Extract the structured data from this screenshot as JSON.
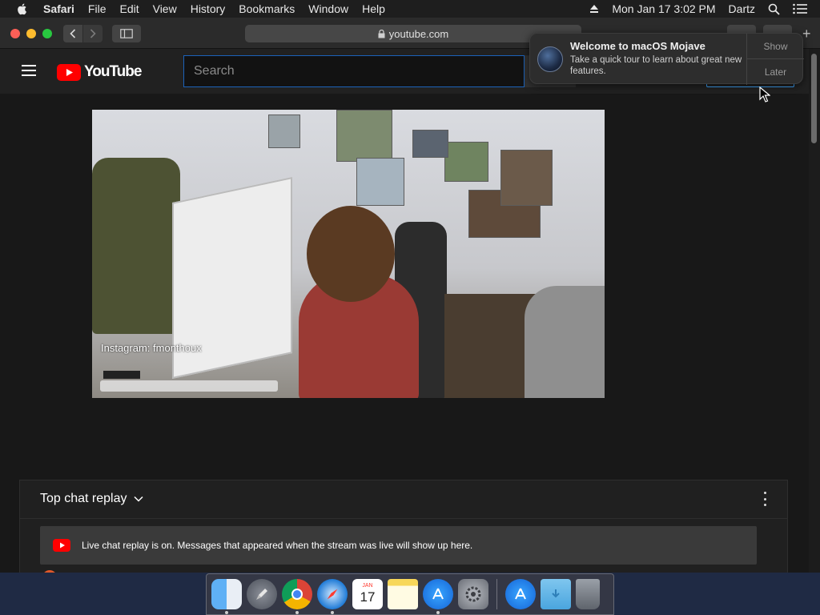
{
  "menubar": {
    "app_name": "Safari",
    "items": [
      "File",
      "Edit",
      "View",
      "History",
      "Bookmarks",
      "Window",
      "Help"
    ],
    "datetime": "Mon Jan 17  3:02 PM",
    "user": "Dartz"
  },
  "browser": {
    "url": "youtube.com"
  },
  "youtube": {
    "logo_text": "YouTube",
    "search_placeholder": "Search",
    "video_caption": "Instagram: fmonthoux",
    "chat": {
      "title": "Top chat replay",
      "banner_text": "Live chat replay is on. Messages that appeared when the stream was live will show up here."
    }
  },
  "notification": {
    "title": "Welcome to macOS Mojave",
    "body": "Take a quick tour to learn about great new features.",
    "show_label": "Show",
    "later_label": "Later"
  },
  "dock": {
    "calendar_month": "JAN",
    "calendar_day": "17",
    "apps": [
      "finder",
      "launchpad",
      "chrome",
      "safari",
      "calendar",
      "notes",
      "app-store",
      "system-preferences",
      "app-store-downloads",
      "downloads-folder",
      "trash"
    ]
  },
  "colors": {
    "youtube_red": "#ff0000",
    "focus_blue": "#1c62b9"
  }
}
